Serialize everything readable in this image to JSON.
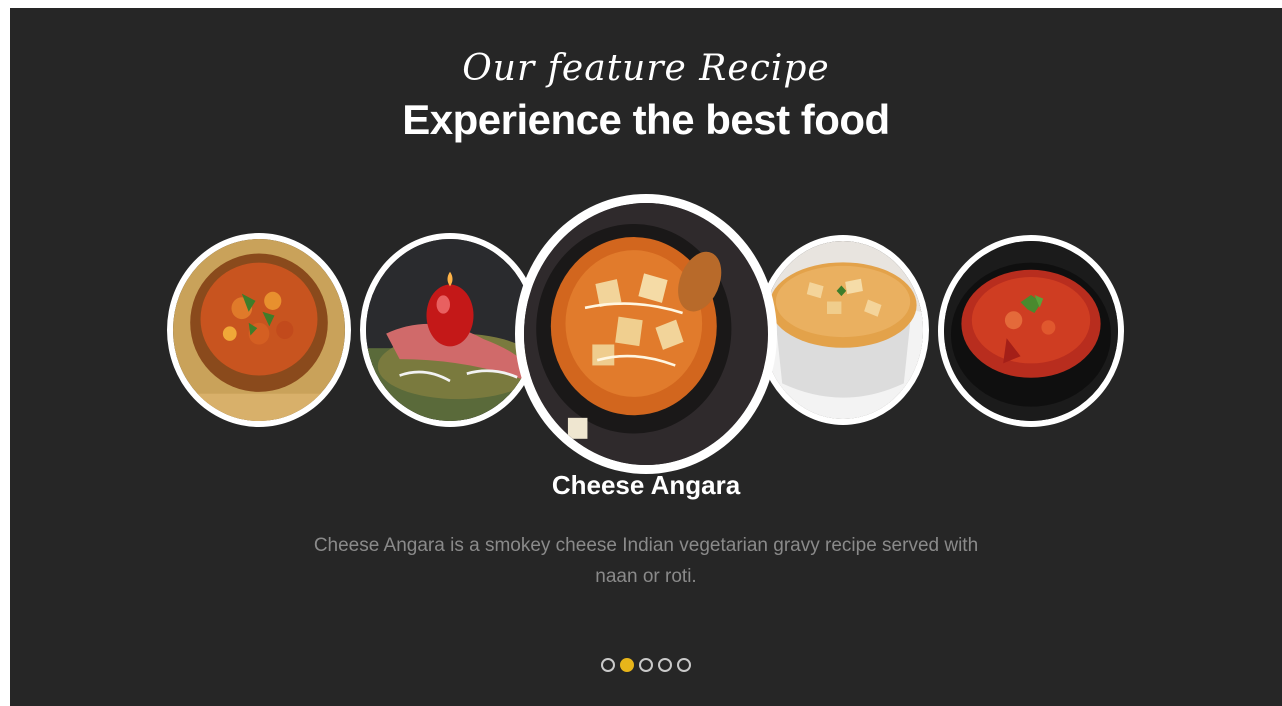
{
  "section": {
    "script_title": "Our feature Recipe",
    "headline": "Experience the best food"
  },
  "carousel": {
    "images": [
      {
        "name": "vegetable-curry-in-copper-bowl-image"
      },
      {
        "name": "garnished-kebab-platter-image"
      },
      {
        "name": "cheese-angara-image"
      },
      {
        "name": "creamy-paneer-curry-white-bowl-image"
      },
      {
        "name": "tomato-curry-black-bowl-image"
      }
    ],
    "active_title": "Cheese Angara",
    "active_description": "Cheese Angara is a smokey cheese Indian vegetarian gravy recipe served with naan or roti.",
    "active_index": 1,
    "dot_count": 5
  },
  "colors": {
    "background": "#262626",
    "accent_dot": "#e8b51a",
    "text_primary": "#ffffff",
    "text_muted": "#8a8a8a"
  }
}
